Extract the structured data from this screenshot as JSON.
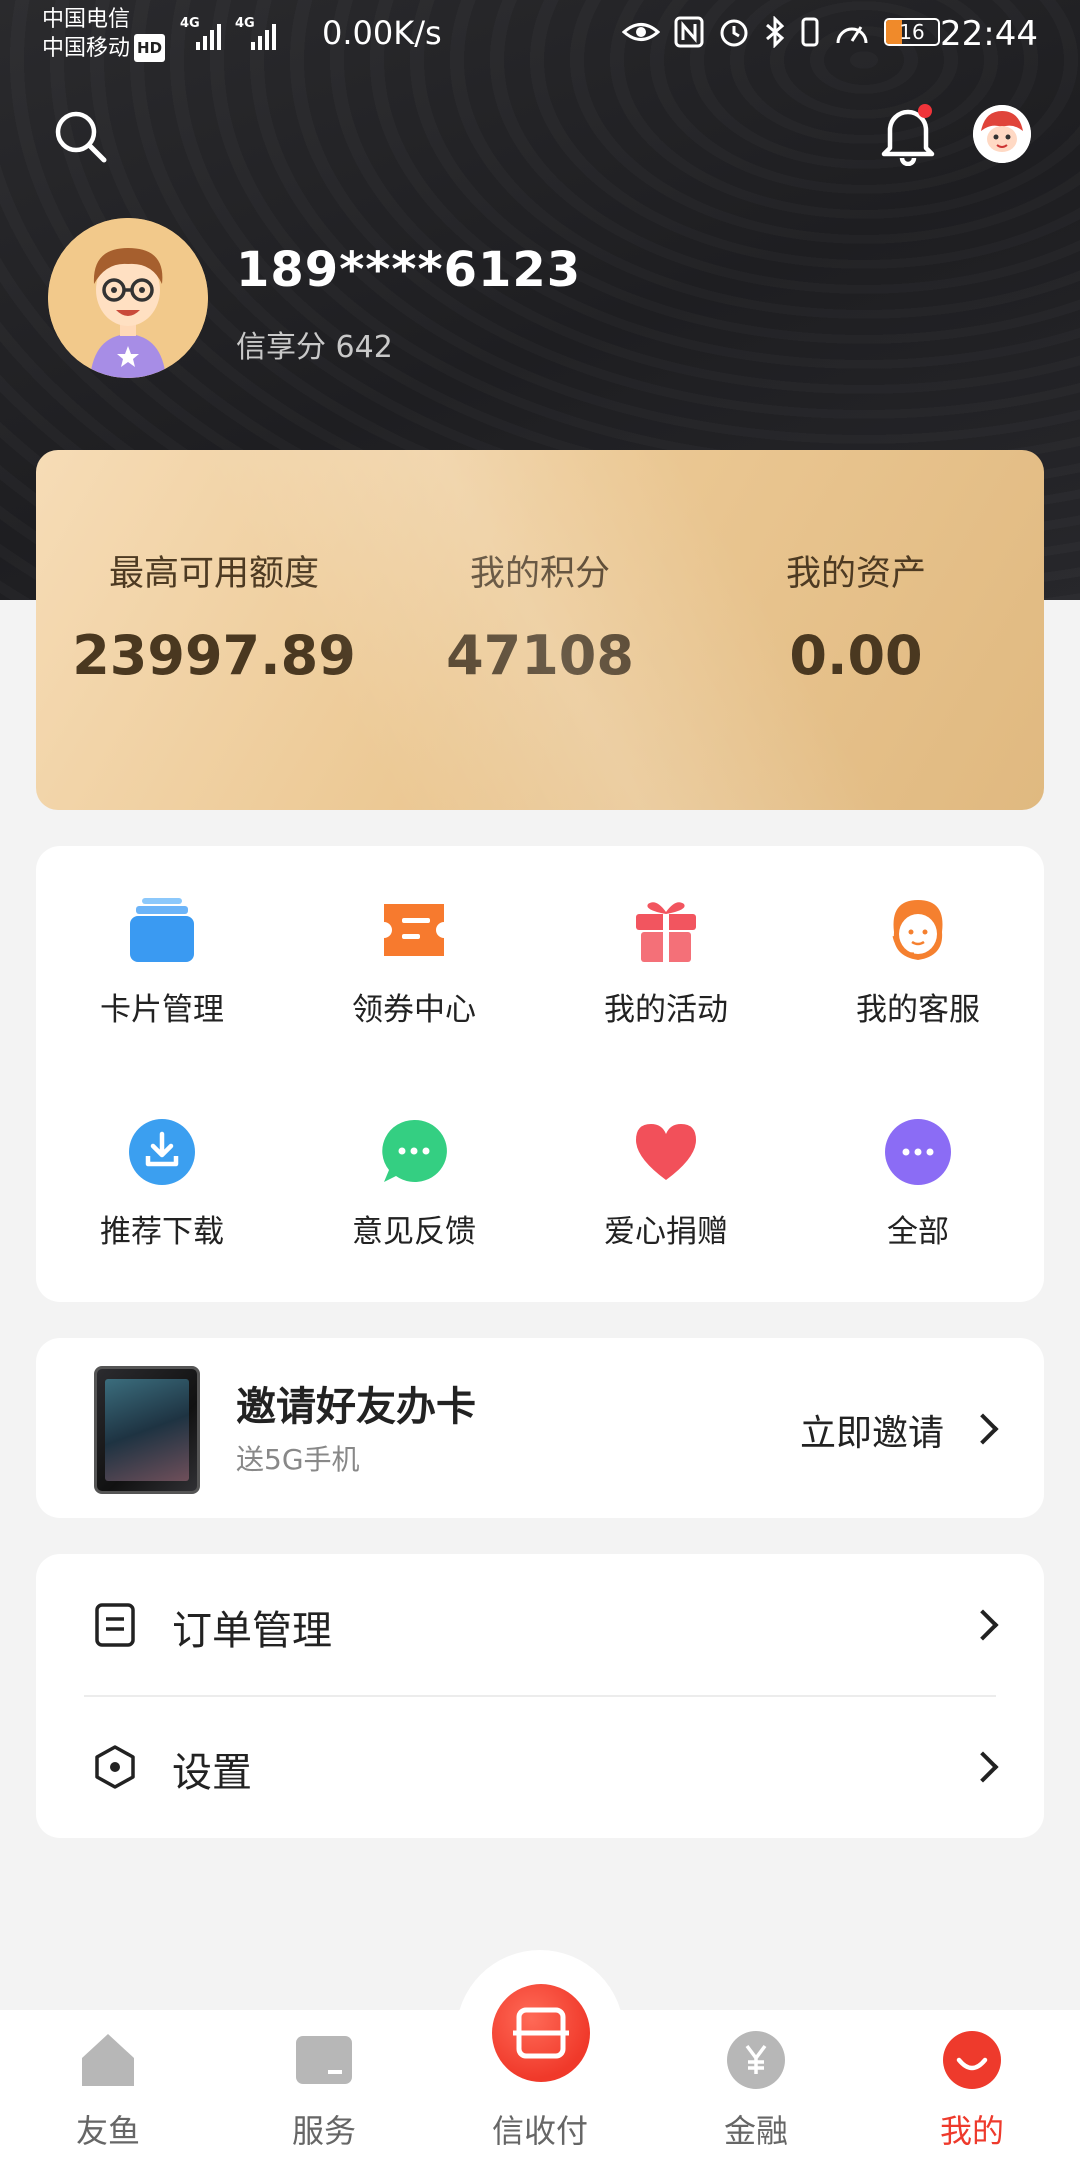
{
  "status_bar": {
    "carrier1": "中国电信",
    "carrier2": "中国移动",
    "hd_badge": "HD",
    "network1": "4G",
    "network2": "4G",
    "speed": "0.00K/s",
    "battery": "16",
    "time": "22:44"
  },
  "header": {
    "phone": "189****6123",
    "score_label": "信享分",
    "score_value": "642"
  },
  "stats": [
    {
      "label": "最高可用额度",
      "value": "23997.89"
    },
    {
      "label": "我的积分",
      "value": "47108"
    },
    {
      "label": "我的资产",
      "value": "0.00"
    }
  ],
  "grid": [
    {
      "label": "卡片管理",
      "icon": "card-stack-icon",
      "color": "#3a9af2"
    },
    {
      "label": "领券中心",
      "icon": "coupon-icon",
      "color": "#f77a2e"
    },
    {
      "label": "我的活动",
      "icon": "gift-icon",
      "color": "#f2555f"
    },
    {
      "label": "我的客服",
      "icon": "customer-service-icon",
      "color": "#f5802f"
    },
    {
      "label": "推荐下载",
      "icon": "download-icon",
      "color": "#3b9ff0"
    },
    {
      "label": "意见反馈",
      "icon": "chat-bubble-icon",
      "color": "#34cf82"
    },
    {
      "label": "爱心捐赠",
      "icon": "heart-icon",
      "color": "#f2505a"
    },
    {
      "label": "全部",
      "icon": "more-icon",
      "color": "#8b6cf5"
    }
  ],
  "invite": {
    "title": "邀请好友办卡",
    "subtitle": "送5G手机",
    "action": "立即邀请"
  },
  "menu": [
    {
      "label": "订单管理",
      "icon": "order-list-icon"
    },
    {
      "label": "设置",
      "icon": "settings-hexagon-icon"
    }
  ],
  "tabs": [
    {
      "label": "友鱼",
      "icon": "home-icon"
    },
    {
      "label": "服务",
      "icon": "service-box-icon"
    },
    {
      "label": "信收付",
      "icon": "scan-pay-icon"
    },
    {
      "label": "金融",
      "icon": "yuan-coin-icon"
    },
    {
      "label": "我的",
      "icon": "smile-profile-icon"
    }
  ],
  "colors": {
    "accent": "#ee3a2c",
    "header_bg": "#222225",
    "card_gold": "#ecc995"
  }
}
